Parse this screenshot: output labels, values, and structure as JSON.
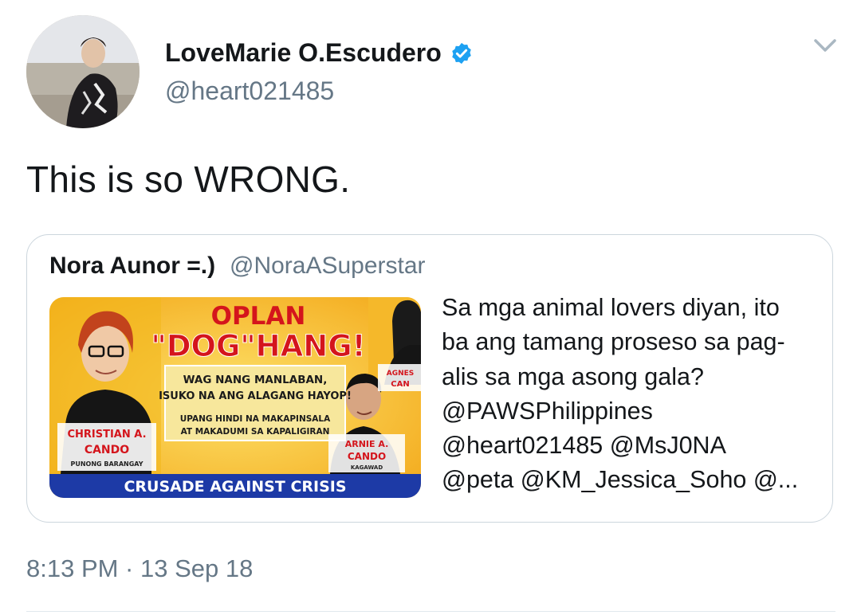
{
  "tweet": {
    "display_name": "LoveMarie O.Escudero",
    "handle": "@heart021485",
    "text": "This is so WRONG.",
    "timestamp": "8:13 PM · 13 Sep 18",
    "verified": true
  },
  "quoted_tweet": {
    "display_name": "Nora Aunor =.)",
    "handle": "@NoraASuperstar",
    "text_lines": [
      "Sa mga animal lovers diyan, ito",
      "ba ang tamang proseso sa pag-",
      "alis sa mga asong gala?",
      "@PAWSPhilippines",
      "@heart021485 @MsJ0NA",
      "@peta @KM_Jessica_Soho @..."
    ],
    "image": {
      "headline_1": "OPLAN",
      "headline_2": "\"DOG\"HANG!",
      "message_1": "WAG NANG MANLABAN,",
      "message_2": "ISUKO NA ANG ALAGANG HAYOP!",
      "message_3": "UPANG HINDI NA MAKAPINSALA",
      "message_4": "AT MAKADUMI SA KAPALIGIRAN",
      "person_1_first": "CHRISTIAN A.",
      "person_1_last": "CANDO",
      "person_1_title": "PUNONG BARANGAY",
      "person_2_first": "ARNIE A.",
      "person_2_last": "CANDO",
      "person_2_title": "KAGAWAD",
      "person_3_first": "AGNES",
      "person_3_last": "CAN",
      "banner": "CRUSADE AGAINST CRISIS"
    }
  },
  "colors": {
    "text_primary": "#14171a",
    "text_secondary": "#657786",
    "verified_blue": "#1da1f2",
    "border": "#ccd6dd",
    "poster_yellow": "#f7c21b",
    "poster_red": "#d4151c",
    "poster_blue": "#1d3aa6"
  },
  "icons": {
    "verified": "verified-badge-icon",
    "menu": "chevron-down-icon"
  }
}
